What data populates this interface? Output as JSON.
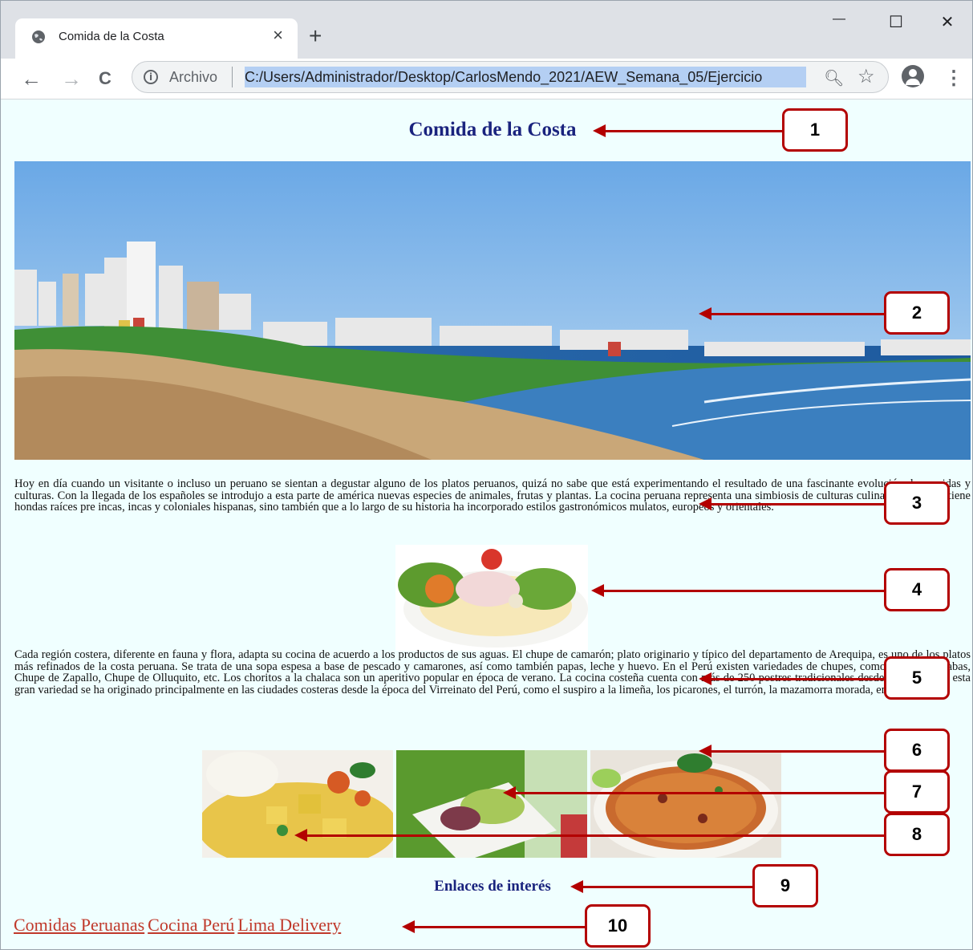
{
  "browser": {
    "tab_title": "Comida de la Costa",
    "tab_close": "×",
    "new_tab": "+",
    "url_scheme": "Archivo",
    "url": "C:/Users/Administrador/Desktop/CarlosMendo_2021/AEW_Semana_05/Ejercicio",
    "window_controls": {
      "minimize": "—",
      "maximize": "☐",
      "close": "✕"
    },
    "nav": {
      "back": "←",
      "forward": "→",
      "reload": "C"
    },
    "icons": {
      "zoom": "search-icon",
      "star": "star-icon",
      "menu": "kebab-menu-icon"
    }
  },
  "page": {
    "title": "Comida de la Costa",
    "paragraph_1": "Hoy en día cuando un visitante o incluso un peruano se sientan a degustar alguno de los platos peruanos, quizá no sabe que está experimentando el resultado de una fascinante evolución de comidas y culturas. Con la llegada de los españoles se introdujo a esta parte de américa nuevas especies de animales, frutas y plantas. La cocina peruana representa una simbiosis de culturas culinarias. No sólo tiene hondas raíces pre incas, incas y coloniales hispanas, sino también que a lo largo de su historia ha incorporado estilos gastronómicos mulatos, europeos y orientales.",
    "paragraph_2": "Cada región costera, diferente en fauna y flora, adapta su cocina de acuerdo a los productos de sus aguas. El chupe de camarón; plato originario y típico del departamento de Arequipa, es uno de los platos más refinados de la costa peruana. Se trata de una sopa espesa a base de pescado y camarones, así como también papas, leche y huevo. En el Perú existen variedades de chupes, como: Chupe de habas, Chupe de Zapallo, Chupe de Olluquito, etc. Los choritos a la chalaca son un aperitivo popular en época de verano. La cocina costeña cuenta con más de 250 postres tradicionales desde el siglo XIX, esta gran variedad se ha originado principalmente en las ciudades costeras desde la época del Virreinato del Perú, como el suspiro a la limeña, los picarones, el turrón, la mazamorra morada, entre otros.",
    "subtitle": "Enlaces de interés",
    "links": [
      "Comidas Peruanas",
      "Cocina Perú",
      "Lima Delivery"
    ]
  },
  "callouts": [
    "1",
    "2",
    "3",
    "4",
    "5",
    "6",
    "7",
    "8",
    "9",
    "10"
  ],
  "colors": {
    "page_bg": "#f0ffff",
    "heading": "#1a237e",
    "link": "#c0392b",
    "callout": "#b30000"
  }
}
